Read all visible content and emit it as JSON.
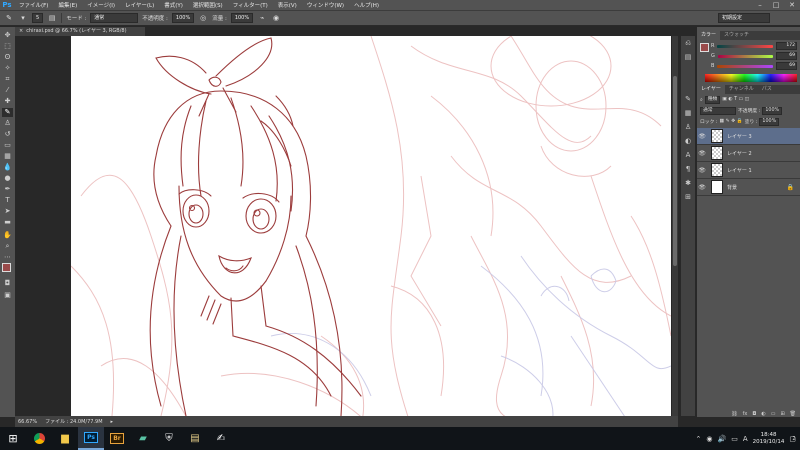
{
  "app": {
    "logo": "Ps",
    "menus": [
      "ファイル(F)",
      "編集(E)",
      "イメージ(I)",
      "レイヤー(L)",
      "書式(Y)",
      "選択範囲(S)",
      "フィルター(T)",
      "表示(V)",
      "ウィンドウ(W)",
      "ヘルプ(H)"
    ],
    "window_buttons": [
      "–",
      "□",
      "✕"
    ]
  },
  "options_bar": {
    "mode_label": "モード :",
    "mode_value": "通常",
    "opacity_label": "不透明度 :",
    "opacity_value": "100%",
    "flow_label": "流量 :",
    "flow_value": "100%",
    "workspace": "初期設定"
  },
  "document": {
    "tab_title": "chiraxi.psd @ 66.7% (レイヤー 3, RGB/8)",
    "zoom": "66.67%",
    "file_info": "ファイル : 24.0M/77.9M"
  },
  "panels": {
    "color_tabs": [
      "カラー",
      "スウォッチ"
    ],
    "color_sliders": [
      {
        "label": "R",
        "value": "172",
        "color": "#ac4545"
      },
      {
        "label": "G",
        "value": "69",
        "color": "#45a845"
      },
      {
        "label": "B",
        "value": "69",
        "color": "#4545ac"
      }
    ],
    "layers_tabs": [
      "レイヤー",
      "チャンネル",
      "パス"
    ],
    "kind_label": "種類",
    "blend_mode": "通常",
    "opacity_label": "不透明度 :",
    "opacity_value": "100%",
    "lock_label": "ロック :",
    "fill_label": "塗り :",
    "fill_value": "100%",
    "layers": [
      {
        "name": "レイヤー 3",
        "thumb": "checker",
        "active": true
      },
      {
        "name": "レイヤー 2",
        "thumb": "checker",
        "active": false
      },
      {
        "name": "レイヤー 1",
        "thumb": "checker",
        "active": false
      },
      {
        "name": "背景",
        "thumb": "white",
        "active": false
      }
    ]
  },
  "taskbar": {
    "apps": [
      "chrome-icon",
      "file-explorer-icon",
      "photoshop-icon",
      "bridge-icon",
      "notebook-icon",
      "security-shield-icon",
      "scanner-icon",
      "signature-icon"
    ],
    "time": "18:48",
    "date": "2019/10/14",
    "ime": "A",
    "notifications": "2"
  },
  "colors": {
    "foreground": "#9a4a4a",
    "background": "#ffffff",
    "accent_blue": "#31a8ff",
    "sketch_line": "#9c3c3c",
    "sketch_light": "#e8b0b0",
    "sketch_lilac": "#c8c8e8"
  }
}
